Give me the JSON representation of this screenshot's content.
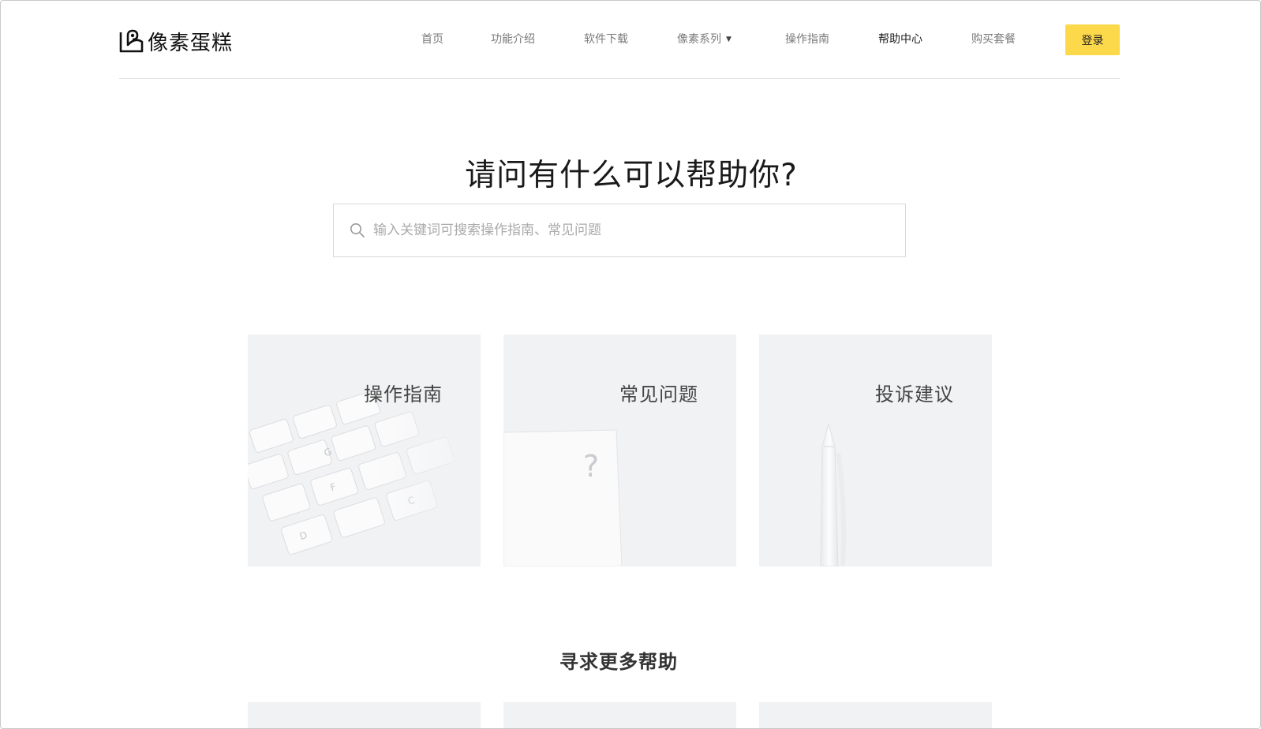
{
  "brand": {
    "name": "像素蛋糕"
  },
  "nav": {
    "items": [
      {
        "label": "首页"
      },
      {
        "label": "功能介绍"
      },
      {
        "label": "软件下载"
      },
      {
        "label": "像素系列"
      },
      {
        "label": "操作指南"
      },
      {
        "label": "帮助中心"
      },
      {
        "label": "购买套餐"
      }
    ],
    "login_label": "登录"
  },
  "hero": {
    "title": "请问有什么可以帮助你?",
    "search_placeholder": "输入关键词可搜索操作指南、常见问题",
    "search_value": ""
  },
  "cards": [
    {
      "title": "操作指南"
    },
    {
      "title": "常见问题"
    },
    {
      "title": "投诉建议"
    }
  ],
  "more": {
    "title": "寻求更多帮助"
  },
  "colors": {
    "accent": "#fcd84b",
    "card_bg": "#f1f2f4",
    "divider": "#e2e2e2"
  },
  "icons": [
    "logo-icon",
    "caret-down-icon",
    "search-icon"
  ]
}
